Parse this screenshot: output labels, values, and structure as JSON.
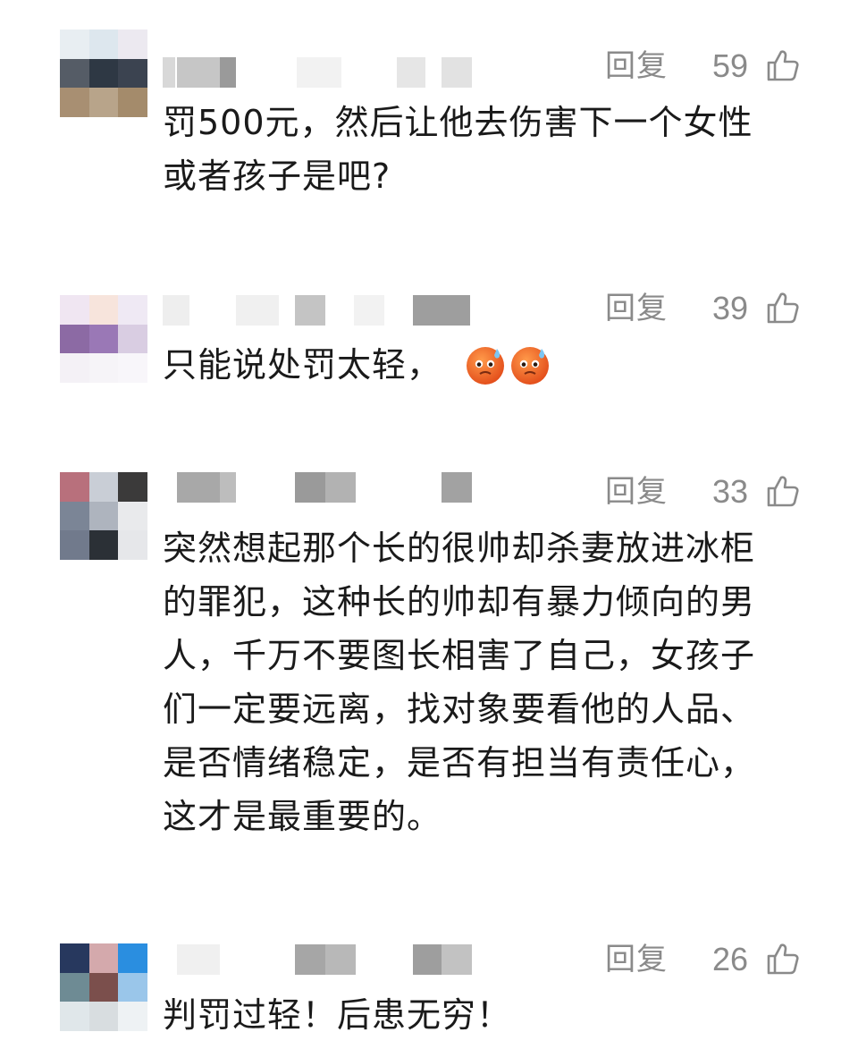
{
  "reply_label": "回复",
  "thumb_icon": "thumbs-up-outline-icon",
  "comments": [
    {
      "text": "罚500元，然后让他去伤害下一个女性\n或者孩子是吧?",
      "likes": "59",
      "avatar_colors": [
        "#e8eef2",
        "#dde7ee",
        "#ece9f0",
        "#555c66",
        "#2e3844",
        "#3b4350",
        "#a88f72",
        "#b8a48a",
        "#a48b6b"
      ]
    },
    {
      "text": "只能说处罚太轻，",
      "likes": "39",
      "emojis": [
        "anxious-sweat-emoji",
        "anxious-sweat-emoji"
      ],
      "avatar_colors": [
        "#f0e6f2",
        "#f7e4dc",
        "#efe9f4",
        "#8c6aa4",
        "#9a78b6",
        "#d9cde2",
        "#f4f1f6",
        "#f6f4f8",
        "#f8f6fa"
      ]
    },
    {
      "text": "突然想起那个长的很帅却杀妻放进冰柜\n的罪犯，这种长的帅却有暴力倾向的男\n人，千万不要图长相害了自己，女孩子\n们一定要远离，找对象要看他的人品、\n是否情绪稳定，是否有担当有责任心，\n这才是最重要的。",
      "likes": "33",
      "avatar_colors": [
        "#b8707c",
        "#c9ced6",
        "#3b3a3a",
        "#7b8596",
        "#aeb4be",
        "#e9eaec",
        "#717a8c",
        "#2b3036",
        "#e6e7ea"
      ]
    },
    {
      "text": "判罚过轻！后患无穷！",
      "likes": "26",
      "avatar_colors": [
        "#27385e",
        "#d4a9ac",
        "#2a8ee0",
        "#6e8b94",
        "#7b4f4c",
        "#9ac6ea",
        "#e0e7ea",
        "#d8dde0",
        "#eef2f4"
      ]
    }
  ]
}
